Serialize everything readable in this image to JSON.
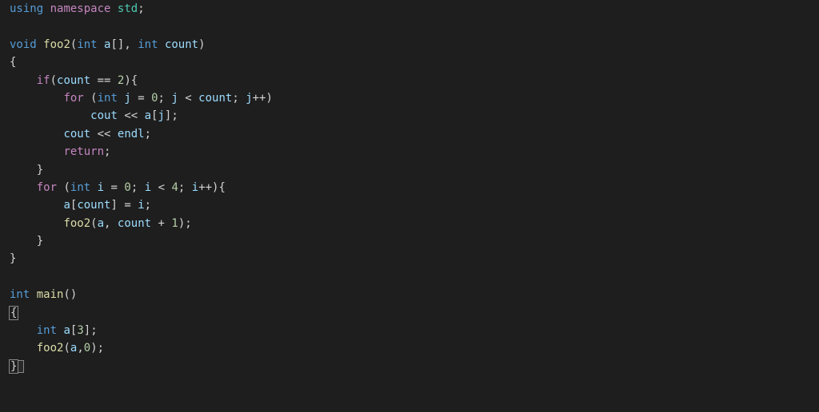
{
  "tokens": {
    "using": "using",
    "namespace": "namespace",
    "std": "std",
    "void": "void",
    "int": "int",
    "foo2": "foo2",
    "a": "a",
    "count": "count",
    "if": "if",
    "for": "for",
    "j": "j",
    "i": "i",
    "cout": "cout",
    "endl": "endl",
    "return": "return",
    "main": "main",
    "n0": "0",
    "n1": "1",
    "n2": "2",
    "n3": "3",
    "n4": "4"
  },
  "code_listing": [
    "using namespace std;",
    "",
    "void foo2(int a[], int count)",
    "{",
    "    if(count == 2){",
    "        for (int j = 0; j < count; j++)",
    "            cout << a[j];",
    "        cout << endl;",
    "        return;",
    "    }",
    "    for (int i = 0; i < 4; i++){",
    "        a[count] = i;",
    "        foo2(a, count + 1);",
    "    }",
    "}",
    "",
    "int main()",
    "{",
    "    int a[3];",
    "    foo2(a,0);",
    "}"
  ]
}
